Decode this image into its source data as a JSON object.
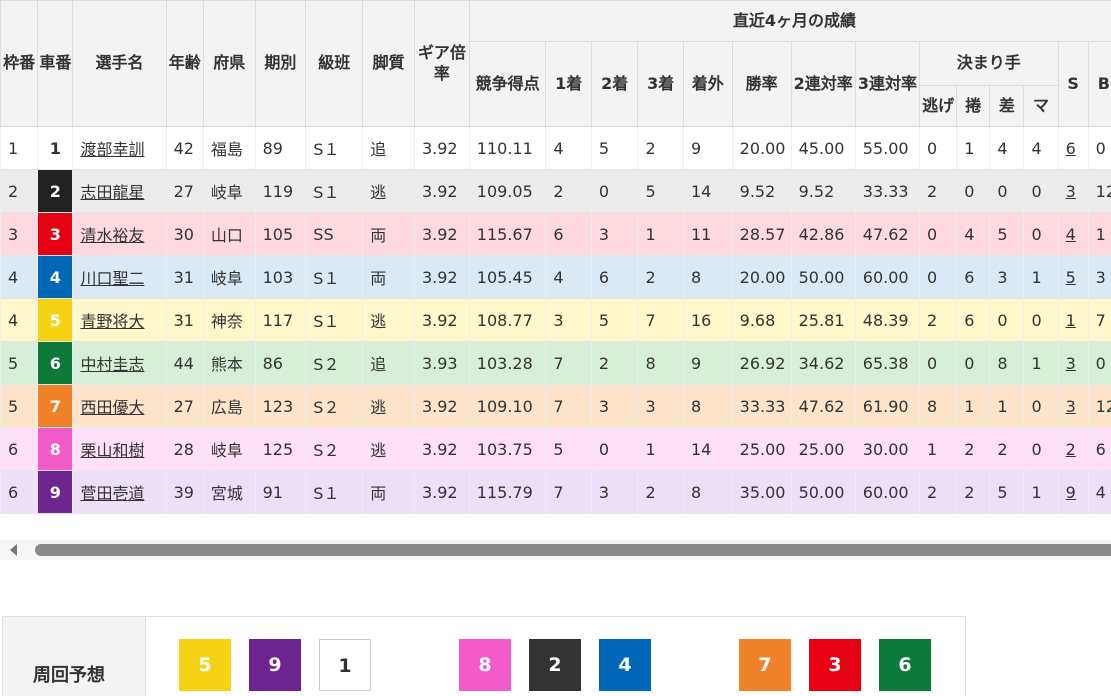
{
  "headers": {
    "waku": "枠番",
    "sha": "車番",
    "name": "選手名",
    "age": "年齢",
    "pref": "府県",
    "term": "期別",
    "class": "級班",
    "style": "脚質",
    "gear": "ギア倍率",
    "recent": "直近4ヶ月の成績",
    "score": "競争得点",
    "first": "1着",
    "second": "2着",
    "third": "3着",
    "out": "着外",
    "win": "勝率",
    "rentai2": "2連対率",
    "rentai3": "3連対率",
    "kimarite": "決まり手",
    "nige": "逃げ",
    "makuri": "捲",
    "sashi": "差",
    "mark": "マ",
    "s": "S",
    "b": "B"
  },
  "rows": [
    {
      "waku": "1",
      "car": "1",
      "car_bg": "#ffffff",
      "car_fg": "#333333",
      "name": "渡部幸訓",
      "age": "42",
      "pref": "福島",
      "term": "89",
      "class": "S１",
      "style": "追",
      "gear": "3.92",
      "score": "110.11",
      "first": "4",
      "second": "5",
      "third": "2",
      "out": "9",
      "win": "20.00",
      "r2": "45.00",
      "r3": "55.00",
      "nige": "0",
      "makuri": "1",
      "sashi": "4",
      "mark": "4",
      "s": "6",
      "b": "0",
      "row_bg": "#ffffff"
    },
    {
      "waku": "2",
      "car": "2",
      "car_bg": "#222222",
      "car_fg": "#ffffff",
      "name": "志田龍星",
      "age": "27",
      "pref": "岐阜",
      "term": "119",
      "class": "S１",
      "style": "逃",
      "gear": "3.92",
      "score": "109.05",
      "first": "2",
      "second": "0",
      "third": "5",
      "out": "14",
      "win": "9.52",
      "r2": "9.52",
      "r3": "33.33",
      "nige": "2",
      "makuri": "0",
      "sashi": "0",
      "mark": "0",
      "s": "3",
      "b": "12",
      "row_bg": "#ececec"
    },
    {
      "waku": "3",
      "car": "3",
      "car_bg": "#e60012",
      "car_fg": "#ffffff",
      "name": "清水裕友",
      "age": "30",
      "pref": "山口",
      "term": "105",
      "class": "SS",
      "style": "両",
      "gear": "3.92",
      "score": "115.67",
      "first": "6",
      "second": "3",
      "third": "1",
      "out": "11",
      "win": "28.57",
      "r2": "42.86",
      "r3": "47.62",
      "nige": "0",
      "makuri": "4",
      "sashi": "5",
      "mark": "0",
      "s": "4",
      "b": "1",
      "row_bg": "#ffd9e0"
    },
    {
      "waku": "4",
      "car": "4",
      "car_bg": "#0068b7",
      "car_fg": "#ffffff",
      "name": "川口聖二",
      "age": "31",
      "pref": "岐阜",
      "term": "103",
      "class": "S１",
      "style": "両",
      "gear": "3.92",
      "score": "105.45",
      "first": "4",
      "second": "6",
      "third": "2",
      "out": "8",
      "win": "20.00",
      "r2": "50.00",
      "r3": "60.00",
      "nige": "0",
      "makuri": "6",
      "sashi": "3",
      "mark": "1",
      "s": "5",
      "b": "3",
      "row_bg": "#dbe8f6"
    },
    {
      "waku": "4",
      "car": "5",
      "car_bg": "#f5d214",
      "car_fg": "#ffffff",
      "name": "青野将大",
      "age": "31",
      "pref": "神奈",
      "term": "117",
      "class": "S１",
      "style": "逃",
      "gear": "3.92",
      "score": "108.77",
      "first": "3",
      "second": "5",
      "third": "7",
      "out": "16",
      "win": "9.68",
      "r2": "25.81",
      "r3": "48.39",
      "nige": "2",
      "makuri": "6",
      "sashi": "0",
      "mark": "0",
      "s": "1",
      "b": "7",
      "row_bg": "#fff8cc"
    },
    {
      "waku": "5",
      "car": "6",
      "car_bg": "#0d7a3a",
      "car_fg": "#ffffff",
      "name": "中村圭志",
      "age": "44",
      "pref": "熊本",
      "term": "86",
      "class": "S２",
      "style": "追",
      "gear": "3.93",
      "score": "103.28",
      "first": "7",
      "second": "2",
      "third": "8",
      "out": "9",
      "win": "26.92",
      "r2": "34.62",
      "r3": "65.38",
      "nige": "0",
      "makuri": "0",
      "sashi": "8",
      "mark": "1",
      "s": "3",
      "b": "0",
      "row_bg": "#d6efd8"
    },
    {
      "waku": "5",
      "car": "7",
      "car_bg": "#f08229",
      "car_fg": "#ffffff",
      "name": "西田優大",
      "age": "27",
      "pref": "広島",
      "term": "123",
      "class": "S２",
      "style": "逃",
      "gear": "3.92",
      "score": "109.10",
      "first": "7",
      "second": "3",
      "third": "3",
      "out": "8",
      "win": "33.33",
      "r2": "47.62",
      "r3": "61.90",
      "nige": "8",
      "makuri": "1",
      "sashi": "1",
      "mark": "0",
      "s": "3",
      "b": "12",
      "row_bg": "#ffe4cc"
    },
    {
      "waku": "6",
      "car": "8",
      "car_bg": "#f35bc8",
      "car_fg": "#ffffff",
      "name": "栗山和樹",
      "age": "28",
      "pref": "岐阜",
      "term": "125",
      "class": "S２",
      "style": "逃",
      "gear": "3.92",
      "score": "103.75",
      "first": "5",
      "second": "0",
      "third": "1",
      "out": "14",
      "win": "25.00",
      "r2": "25.00",
      "r3": "30.00",
      "nige": "1",
      "makuri": "2",
      "sashi": "2",
      "mark": "0",
      "s": "2",
      "b": "6",
      "row_bg": "#ffe0f6"
    },
    {
      "waku": "6",
      "car": "9",
      "car_bg": "#6e248e",
      "car_fg": "#ffffff",
      "name": "菅田壱道",
      "age": "39",
      "pref": "宮城",
      "term": "91",
      "class": "S１",
      "style": "両",
      "gear": "3.92",
      "score": "115.79",
      "first": "7",
      "second": "3",
      "third": "2",
      "out": "8",
      "win": "35.00",
      "r2": "50.00",
      "r3": "60.00",
      "nige": "2",
      "makuri": "2",
      "sashi": "5",
      "mark": "1",
      "s": "9",
      "b": "4",
      "row_bg": "#ece0f8"
    }
  ],
  "forecast": {
    "label": "周回予想",
    "boxes": [
      {
        "num": "5",
        "bg": "#f5d214",
        "fg": "#ffffff"
      },
      {
        "num": "9",
        "bg": "#6e248e",
        "fg": "#ffffff"
      },
      {
        "num": "1",
        "bg": "#ffffff",
        "fg": "#333333"
      },
      {
        "num": "8",
        "bg": "#f35bc8",
        "fg": "#ffffff"
      },
      {
        "num": "2",
        "bg": "#333333",
        "fg": "#ffffff"
      },
      {
        "num": "4",
        "bg": "#0068b7",
        "fg": "#ffffff"
      },
      {
        "num": "7",
        "bg": "#f08229",
        "fg": "#ffffff"
      },
      {
        "num": "3",
        "bg": "#e60012",
        "fg": "#ffffff"
      },
      {
        "num": "6",
        "bg": "#0d7a3a",
        "fg": "#ffffff"
      }
    ]
  }
}
